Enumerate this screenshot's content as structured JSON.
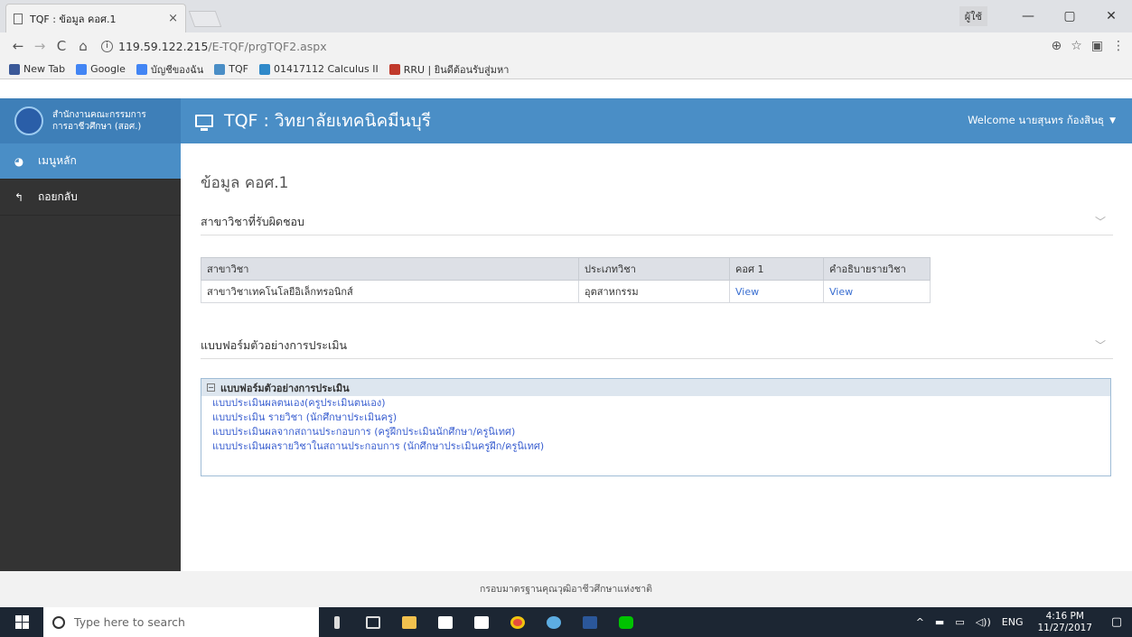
{
  "browser": {
    "tab_title": "TQF : ข้อมูล คอศ.1",
    "tab_close": "×",
    "win_user": "ผู้ใช้",
    "url_host": "119.59.122.215",
    "url_path": "/E-TQF/prgTQF2.aspx",
    "bookmarks": [
      {
        "label": "New Tab",
        "icon": "facebook-icon",
        "color": "#3b5998"
      },
      {
        "label": "Google",
        "icon": "google-icon",
        "color": "#4285f4"
      },
      {
        "label": "บัญชีของฉัน",
        "icon": "google-icon",
        "color": "#4285f4"
      },
      {
        "label": "TQF",
        "icon": "tqf-icon",
        "color": "#4a8ec6"
      },
      {
        "label": "01417112 Calculus II",
        "icon": "sigma-icon",
        "color": "#2f89c9"
      },
      {
        "label": "RRU | ยินดีต้อนรับสู่มหา",
        "icon": "rru-icon",
        "color": "#c0392b"
      }
    ]
  },
  "header": {
    "brand_line1": "สำนักงานคณะกรรมการ",
    "brand_line2": "การอาชีวศึกษา (สอศ.)",
    "title": "TQF : วิทยาลัยเทคนิคมีนบุรี",
    "welcome": "Welcome นายสุนทร ก้องสินธุ"
  },
  "sidebar": {
    "items": [
      {
        "label": "เมนูหลัก",
        "icon": "dashboard-icon"
      },
      {
        "label": "ถอยกลับ",
        "icon": "back-arrow-icon"
      }
    ]
  },
  "main": {
    "page_title": "ข้อมูล คอศ.1",
    "section1_title": "สาขาวิชาที่รับผิดชอบ",
    "table": {
      "headers": [
        "สาขาวิชา",
        "ประเภทวิชา",
        "คอศ 1",
        "คำอธิบายรายวิชา"
      ],
      "rows": [
        [
          "สาขาวิชาเทคโนโลยีอิเล็กทรอนิกส์",
          "อุตสาหกรรม",
          "View",
          "View"
        ]
      ]
    },
    "section2_title": "แบบฟอร์มตัวอย่างการประเมิน",
    "tree": {
      "root": "แบบฟอร์มตัวอย่างการประเมิน",
      "items": [
        "แบบประเมินผลตนเอง(ครูประเมินตนเอง)",
        "แบบประเมิน รายวิชา (นักศึกษาประเมินครู)",
        "แบบประเมินผลจากสถานประกอบการ (ครูฝึกประเมินนักศึกษา/ครูนิเทศ)",
        "แบบประเมินผลรายวิชาในสถานประกอบการ (นักศึกษาประเมินครูฝึก/ครูนิเทศ)"
      ]
    }
  },
  "footer": "กรอบมาตรฐานคุณวุฒิอาชีวศึกษาแห่งชาติ",
  "taskbar": {
    "search_placeholder": "Type here to search",
    "lang": "ENG",
    "time": "4:16 PM",
    "date": "11/27/2017"
  }
}
